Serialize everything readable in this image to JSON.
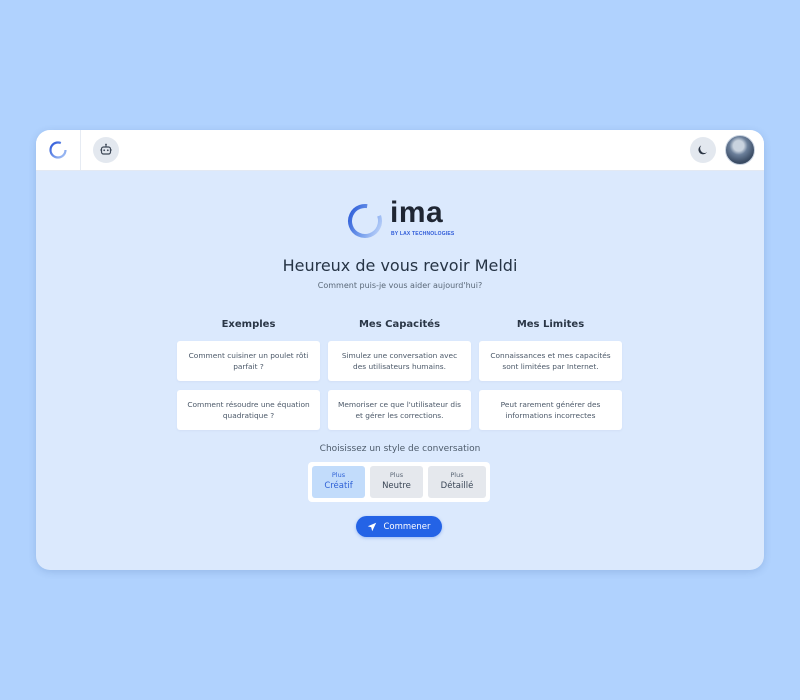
{
  "header": {
    "logo_icon": "ima-ring-logo-icon",
    "bot_icon": "robot-icon",
    "theme_icon": "moon-icon",
    "avatar_icon": "user-avatar"
  },
  "brand": {
    "name": "ima",
    "tagline": "BY LAX TECHNOLOGIES"
  },
  "welcome": {
    "title": "Heureux de vous revoir Meldi",
    "subtitle": "Comment puis-je vous aider aujourd'hui?"
  },
  "columns": [
    {
      "title": "Exemples",
      "cards": [
        "Comment cuisiner un poulet rôti parfait ?",
        "Comment résoudre une équation quadratique ?"
      ]
    },
    {
      "title": "Mes Capacités",
      "cards": [
        "Simulez une conversation avec des utilisateurs humains.",
        "Memoriser ce que l'utilisateur dis et gérer les corrections."
      ]
    },
    {
      "title": "Mes Limites",
      "cards": [
        "Connaissances et mes capacités sont limitées par Internet.",
        "Peut rarement générer des informations incorrectes"
      ]
    }
  ],
  "style_selector": {
    "label": "Choisissez un style de conversation",
    "options": [
      {
        "prefix": "Plus",
        "label": "Créatif",
        "selected": true
      },
      {
        "prefix": "Plus",
        "label": "Neutre",
        "selected": false
      },
      {
        "prefix": "Plus",
        "label": "Détaillé",
        "selected": false
      }
    ]
  },
  "start_button": {
    "label": "Commener",
    "icon": "send-icon"
  },
  "colors": {
    "background": "#b0d2fe",
    "panel": "#dbe9fd",
    "accent": "#2463e6",
    "selected_option": "#c2dcfb"
  }
}
